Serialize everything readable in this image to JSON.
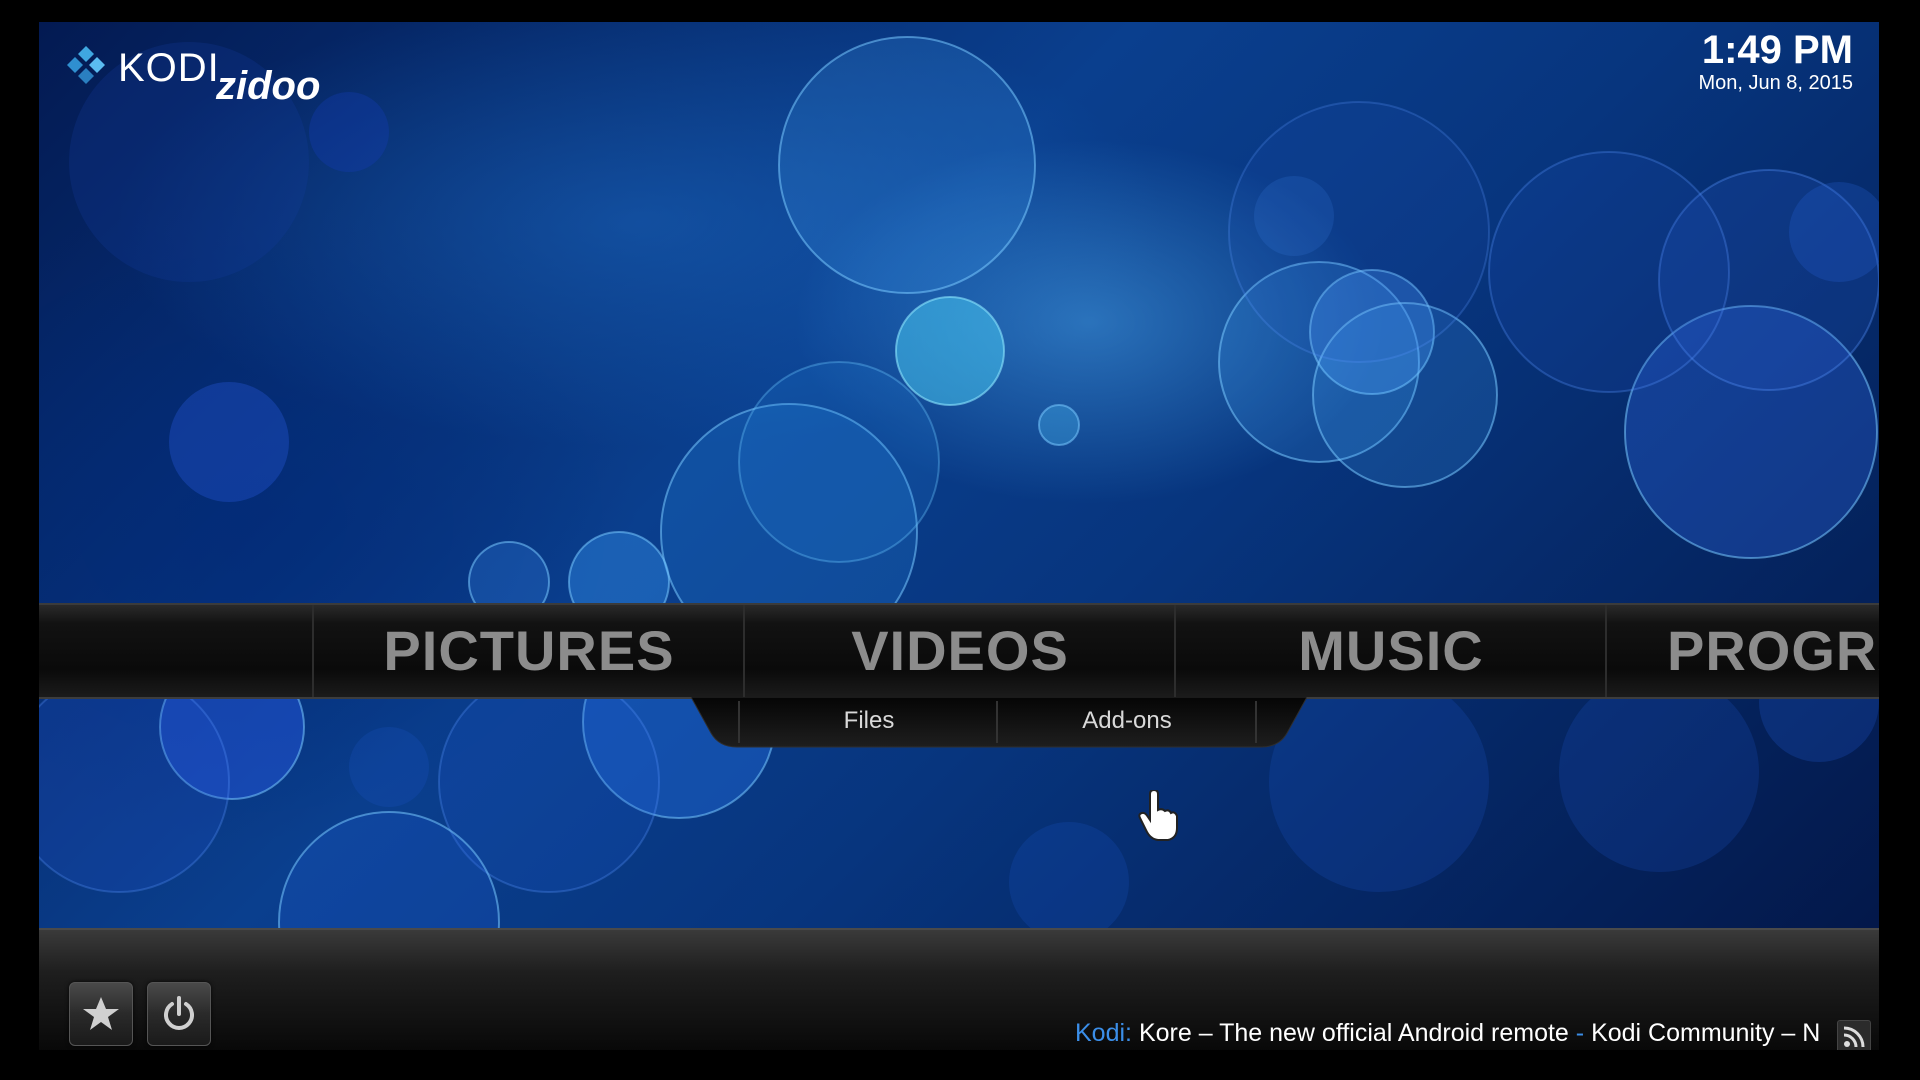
{
  "header": {
    "logo_text_kodi": "KODI",
    "logo_text_brand": "zidoo",
    "time": "1:49 PM",
    "date": "Mon, Jun 8, 2015"
  },
  "main_menu": {
    "items": [
      {
        "label": "PICTURES"
      },
      {
        "label": "VIDEOS"
      },
      {
        "label": "MUSIC"
      },
      {
        "label": "PROGRA"
      }
    ]
  },
  "submenu": {
    "items": [
      {
        "label": "Files"
      },
      {
        "label": "Add-ons"
      }
    ]
  },
  "bottom_bar": {
    "favourites_icon": "star-icon",
    "power_icon": "power-icon",
    "rss_icon": "rss-icon",
    "ticker": {
      "source": "Kodi:",
      "headline1": "Kore – The new official Android remote",
      "separator": "-",
      "headline2": "Kodi Community – N"
    }
  },
  "colors": {
    "accent": "#3b8ee8",
    "menu_text": "#8c8c8c",
    "background_blue": "#0a3f8e"
  }
}
